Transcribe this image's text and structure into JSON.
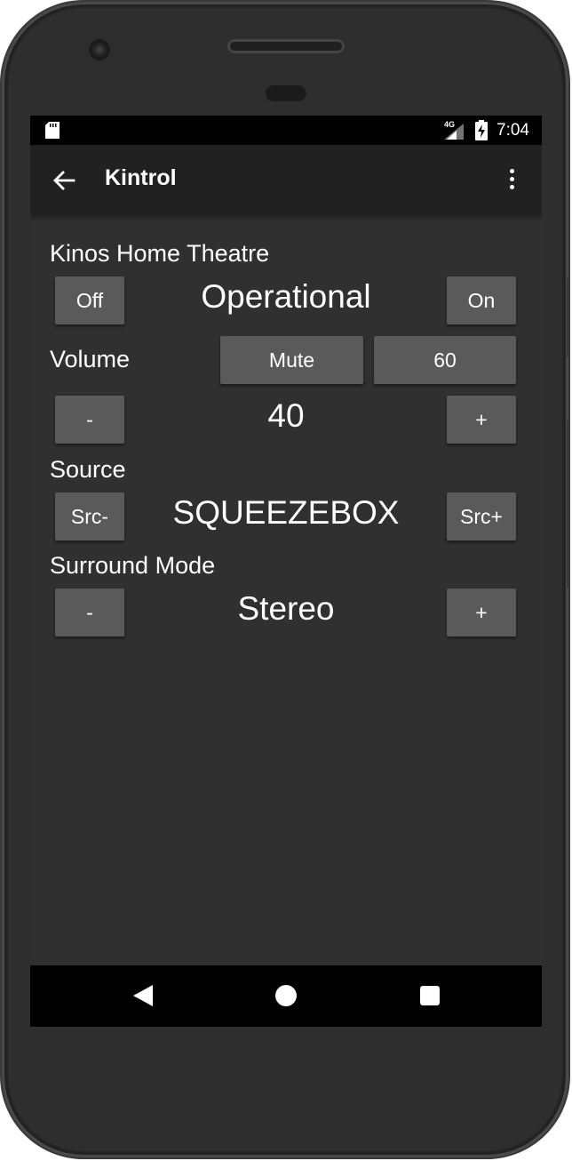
{
  "status_bar": {
    "network": "4G",
    "time": "7:04",
    "icons": [
      "sd-card-icon",
      "signal-icon",
      "battery-charging-icon"
    ]
  },
  "app_bar": {
    "title": "Kintrol",
    "back_icon": "arrow-left-icon",
    "menu_icon": "more-vert-icon"
  },
  "device": {
    "name": "Kinos Home Theatre",
    "off_label": "Off",
    "state": "Operational",
    "on_label": "On"
  },
  "volume": {
    "label": "Volume",
    "mute_label": "Mute",
    "preset_label": "60",
    "minus_label": "-",
    "value": "40",
    "plus_label": "+"
  },
  "source": {
    "label": "Source",
    "prev_label": "Src-",
    "value": "SQUEEZEBOX",
    "next_label": "Src+"
  },
  "surround": {
    "label": "Surround Mode",
    "minus_label": "-",
    "value": "Stereo",
    "plus_label": "+"
  },
  "colors": {
    "background": "#303030",
    "app_bar": "#212121",
    "button": "#5a5a5a",
    "text": "#ffffff"
  }
}
